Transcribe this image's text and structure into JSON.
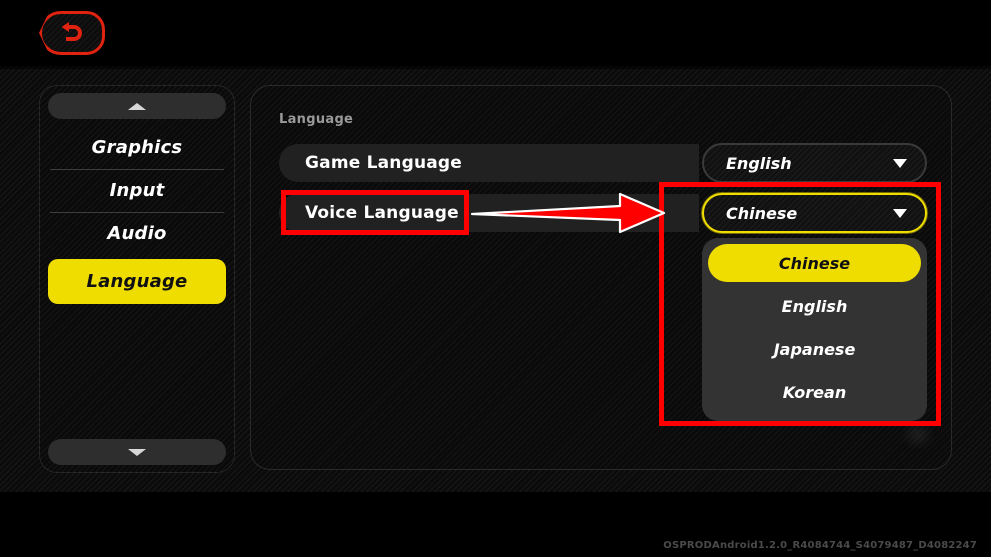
{
  "topbar": {
    "back_button_label": "Back",
    "back_icon": "back-arrow-icon"
  },
  "sidebar": {
    "scroll_up_label": "Scroll up",
    "scroll_down_label": "Scroll down",
    "items": [
      {
        "label": "Graphics",
        "selected": false
      },
      {
        "label": "Input",
        "selected": false
      },
      {
        "label": "Audio",
        "selected": false
      },
      {
        "label": "Language",
        "selected": true
      }
    ]
  },
  "main": {
    "section_title": "Language",
    "rows": [
      {
        "label": "Game Language",
        "value": "English",
        "caret": "chevron-down-icon",
        "active": false
      },
      {
        "label": "Voice Language",
        "value": "Chinese",
        "caret": "chevron-down-icon",
        "active": true
      }
    ],
    "dropdown_open": {
      "for_row": "Voice Language",
      "selected": "Chinese",
      "options": [
        {
          "label": "Chinese",
          "highlighted": true
        },
        {
          "label": "English",
          "highlighted": false
        },
        {
          "label": "Japanese",
          "highlighted": false
        },
        {
          "label": "Korean",
          "highlighted": false
        }
      ]
    }
  },
  "annotations": {
    "highlight_color": "#ff0000",
    "box_voice_label": "Voice Language",
    "box_dropdown": "Voice Language dropdown",
    "arrow": "points from Voice Language label to the dropdown"
  },
  "footer": {
    "build_watermark": "OSPRODAndroid1.2.0_R4084744_S4079487_D4082247"
  },
  "colors": {
    "accent_yellow": "#efdd00",
    "annotation_red": "#ff0000",
    "back_button_red": "#e02210",
    "panel_bg": "#0a0a0a",
    "row_pill": "#212121",
    "dropdown_list_bg": "#333333"
  }
}
